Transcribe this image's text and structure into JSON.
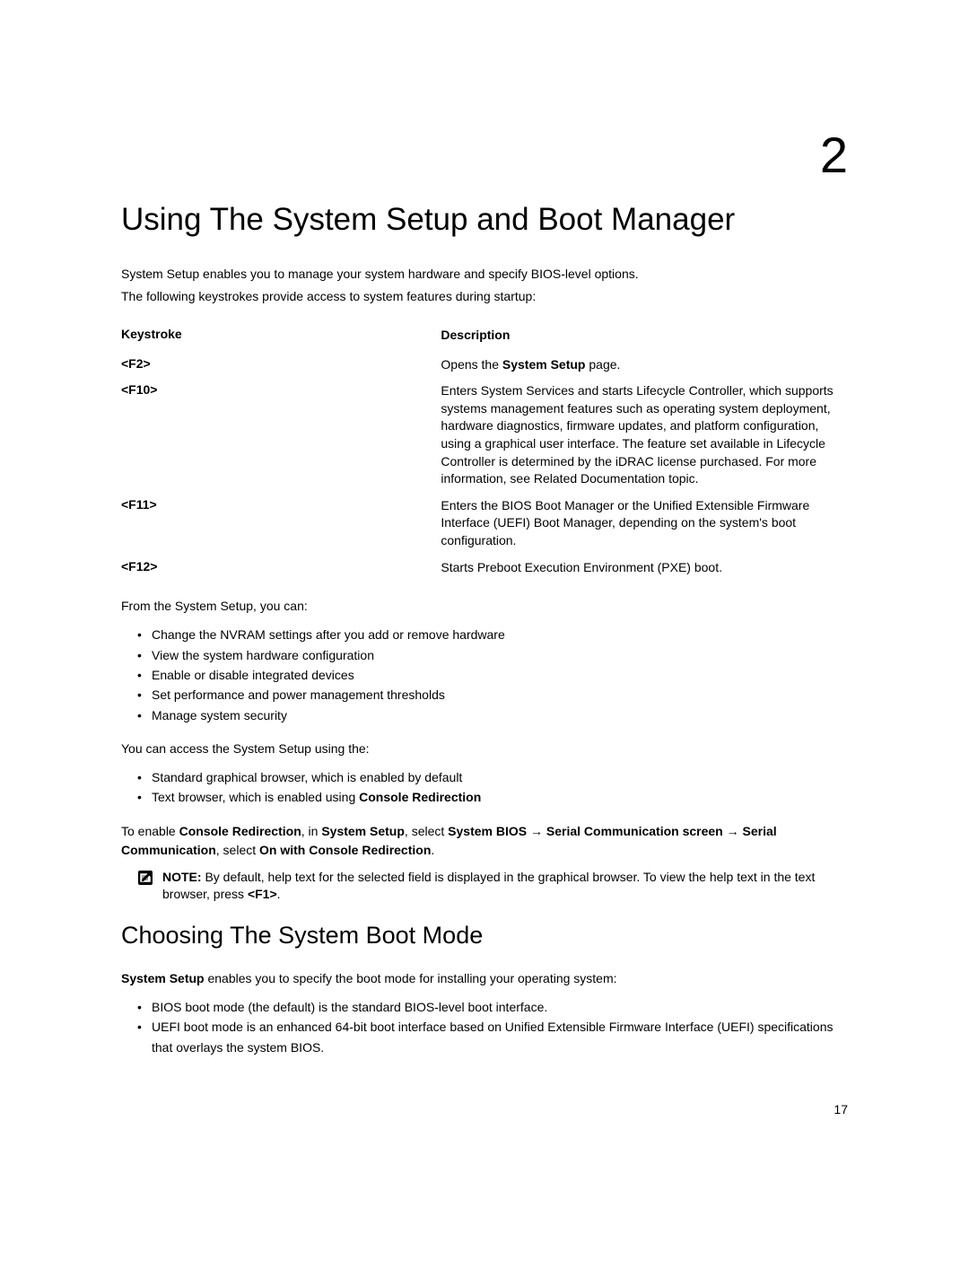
{
  "chapterNumber": "2",
  "chapterTitle": "Using The System Setup and Boot Manager",
  "intro1": "System Setup enables you to manage your system hardware and specify BIOS-level options.",
  "intro2": "The following keystrokes provide access to system features during startup:",
  "tableHeader": {
    "left": "Keystroke",
    "right": "Description"
  },
  "rows": {
    "r1": {
      "key": "<F2>",
      "descPrefix": "Opens the ",
      "descBold": "System Setup",
      "descSuffix": " page."
    },
    "r2": {
      "key": "<F10>",
      "desc": "Enters System Services and starts Lifecycle Controller, which supports systems management features such as operating system deployment, hardware diagnostics, firmware updates, and platform configuration, using a graphical user interface. The feature set available in Lifecycle Controller is determined by the iDRAC license purchased. For more information, see Related Documentation topic."
    },
    "r3": {
      "key": "<F11>",
      "desc": "Enters the BIOS Boot Manager or the Unified Extensible Firmware Interface (UEFI) Boot Manager, depending on the system's boot configuration."
    },
    "r4": {
      "key": "<F12>",
      "desc": "Starts Preboot Execution Environment (PXE) boot."
    }
  },
  "fromSetup": "From the System Setup, you can:",
  "list1": {
    "i1": "Change the NVRAM settings after you add or remove hardware",
    "i2": "View the system hardware configuration",
    "i3": "Enable or disable integrated devices",
    "i4": "Set performance and power management thresholds",
    "i5": "Manage system security"
  },
  "accessText": "You can access the System Setup using the:",
  "list2": {
    "i1": "Standard graphical browser, which is enabled by default",
    "i2pre": "Text browser, which is enabled using ",
    "i2bold": "Console Redirection"
  },
  "enablePara": {
    "p1": "To enable ",
    "b1": "Console Redirection",
    "p2": ", in ",
    "b2": "System Setup",
    "p3": ", select ",
    "b3": "System BIOS",
    "arr1": " → ",
    "b4": "Serial Communication screen",
    "arr2": " → ",
    "b5": "Serial Communication",
    "p4": ", select ",
    "b6": "On with Console Redirection",
    "p5": "."
  },
  "note": {
    "label": "NOTE:",
    "text1": " By default, help text for the selected field is displayed in the graphical browser. To view the help text in the text browser, press ",
    "bold1": "<F1>",
    "text2": "."
  },
  "sectionTitle": "Choosing The System Boot Mode",
  "sectionIntro": {
    "b1": "System Setup",
    "t1": " enables you to specify the boot mode for installing your operating system:"
  },
  "list3": {
    "i1": "BIOS boot mode (the default) is the standard BIOS-level boot interface.",
    "i2": "UEFI boot mode is an enhanced 64-bit boot interface based on Unified Extensible Firmware Interface (UEFI) specifications that overlays the system BIOS."
  },
  "pageNumber": "17"
}
